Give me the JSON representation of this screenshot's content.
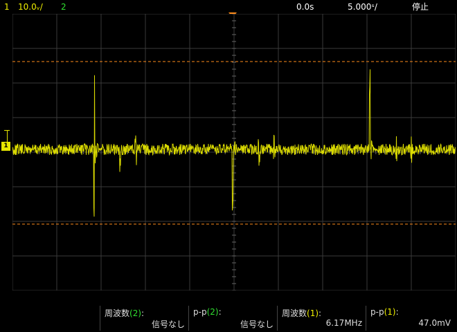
{
  "top": {
    "ch1_num": "1",
    "ch1_scale": "10.0ᵥ/",
    "ch2_num": "2",
    "time_offset": "0.0s",
    "time_scale": "5.000ˢ/",
    "run_state": "停止"
  },
  "markers": {
    "ground": "1"
  },
  "measurements": [
    {
      "label": "周波数",
      "ch": "(2)",
      "ch_color": "c2",
      "suffix": ":",
      "value": "信号なし"
    },
    {
      "label": "p-p",
      "ch": "(2)",
      "ch_color": "c2",
      "suffix": ":",
      "value": "信号なし"
    },
    {
      "label": "周波数",
      "ch": "(1)",
      "ch_color": "c1",
      "suffix": ":",
      "value": "6.17MHz"
    },
    {
      "label": "p-p",
      "ch": "(1)",
      "ch_color": "c1",
      "suffix": ":",
      "value": "47.0mV"
    }
  ],
  "colors": {
    "trace": "#e6e600",
    "grid": "#3a3a3a",
    "cursor": "#ff8c1a",
    "ch2": "#30e030"
  }
}
